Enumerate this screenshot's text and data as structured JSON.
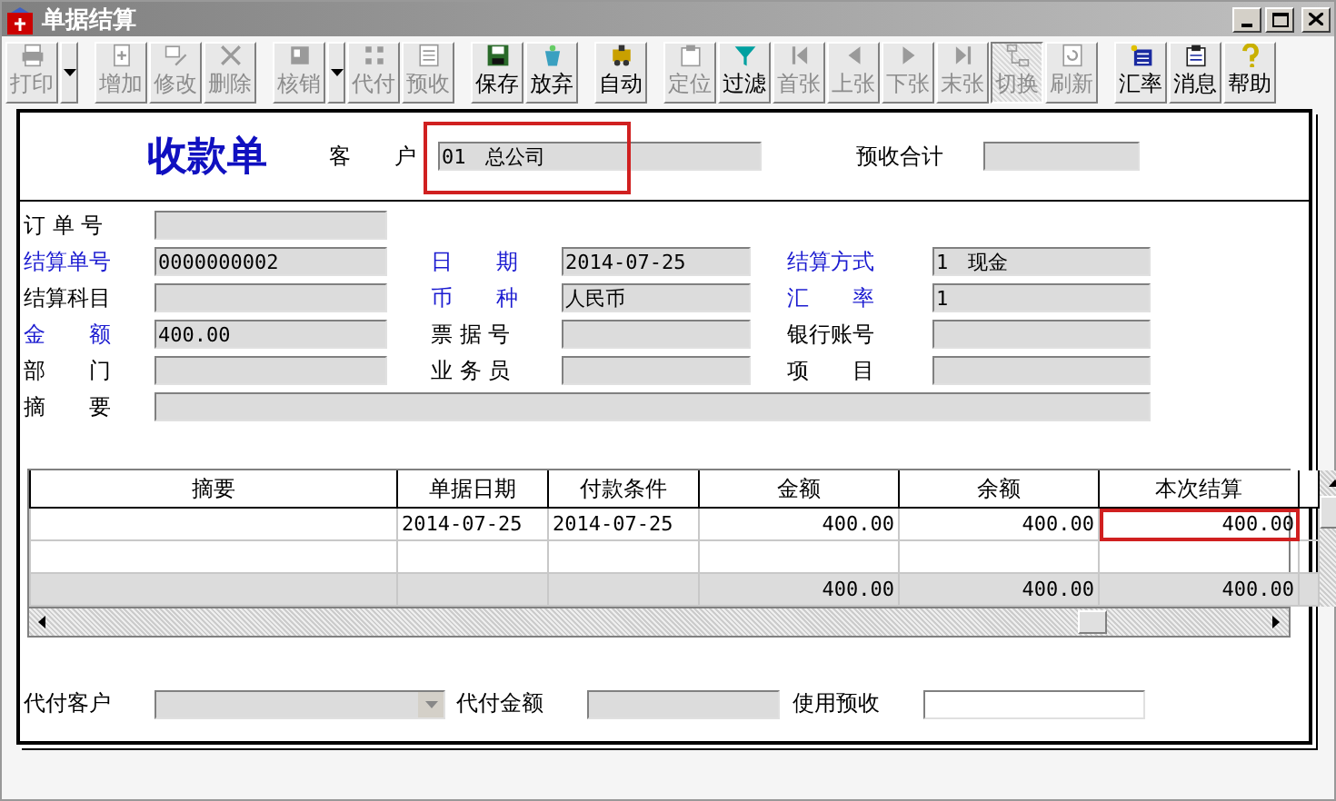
{
  "window": {
    "title": "单据结算"
  },
  "toolbar": [
    {
      "kind": "button",
      "label": "打印",
      "disabled": true,
      "pressed": false
    },
    {
      "kind": "dropdown",
      "disabled": false
    },
    {
      "kind": "spacer"
    },
    {
      "kind": "button",
      "label": "增加",
      "disabled": true,
      "pressed": false
    },
    {
      "kind": "button",
      "label": "修改",
      "disabled": true,
      "pressed": false
    },
    {
      "kind": "button",
      "label": "删除",
      "disabled": true,
      "pressed": false
    },
    {
      "kind": "spacer"
    },
    {
      "kind": "button",
      "label": "核销",
      "disabled": true,
      "pressed": false
    },
    {
      "kind": "dropdown",
      "disabled": false
    },
    {
      "kind": "button",
      "label": "代付",
      "disabled": true,
      "pressed": false
    },
    {
      "kind": "button",
      "label": "预收",
      "disabled": true,
      "pressed": false
    },
    {
      "kind": "spacer"
    },
    {
      "kind": "button",
      "label": "保存",
      "disabled": false,
      "pressed": false
    },
    {
      "kind": "button",
      "label": "放弃",
      "disabled": false,
      "pressed": false
    },
    {
      "kind": "spacer"
    },
    {
      "kind": "button",
      "label": "自动",
      "disabled": false,
      "pressed": false
    },
    {
      "kind": "spacer"
    },
    {
      "kind": "button",
      "label": "定位",
      "disabled": true,
      "pressed": false
    },
    {
      "kind": "button",
      "label": "过滤",
      "disabled": false,
      "pressed": false
    },
    {
      "kind": "button",
      "label": "首张",
      "disabled": true,
      "pressed": false
    },
    {
      "kind": "button",
      "label": "上张",
      "disabled": true,
      "pressed": false
    },
    {
      "kind": "button",
      "label": "下张",
      "disabled": true,
      "pressed": false
    },
    {
      "kind": "button",
      "label": "末张",
      "disabled": true,
      "pressed": false
    },
    {
      "kind": "button",
      "label": "切换",
      "disabled": true,
      "pressed": true
    },
    {
      "kind": "button",
      "label": "刷新",
      "disabled": true,
      "pressed": false
    },
    {
      "kind": "spacer"
    },
    {
      "kind": "button",
      "label": "汇率",
      "disabled": false,
      "pressed": false
    },
    {
      "kind": "button",
      "label": "消息",
      "disabled": false,
      "pressed": false
    },
    {
      "kind": "button",
      "label": "帮助",
      "disabled": false,
      "pressed": false
    }
  ],
  "header": {
    "title": "收款单",
    "customer": {
      "label": "客　　户",
      "value": "01　总公司",
      "highlighted": true
    },
    "prepaid_total": {
      "label": "预收合计"
    }
  },
  "form": [
    [
      {
        "label": "订 单 号",
        "required": false
      }
    ],
    [
      {
        "label": "结算单号",
        "required": true,
        "value": "0000000002"
      },
      {
        "label": "日　　期",
        "required": true,
        "value": "2014-07-25"
      },
      {
        "label": "结算方式",
        "required": true,
        "value": "1　现金"
      }
    ],
    [
      {
        "label": "结算科目",
        "required": false
      },
      {
        "label": "币　　种",
        "required": true,
        "value": "人民币"
      },
      {
        "label": "汇　　率",
        "required": true,
        "value": "1"
      }
    ],
    [
      {
        "label": "金　　额",
        "required": true,
        "value": "400.00"
      },
      {
        "label": "票 据 号",
        "required": false
      },
      {
        "label": "银行账号",
        "required": false
      }
    ],
    [
      {
        "label": "部　　门",
        "required": false
      },
      {
        "label": "业 务 员",
        "required": false
      },
      {
        "label": "项　　目",
        "required": false
      }
    ],
    [
      {
        "label": "摘　　要",
        "required": false,
        "kind": "wide"
      }
    ]
  ],
  "table": {
    "columns": [
      {
        "label": "摘要"
      },
      {
        "label": "单据日期"
      },
      {
        "label": "付款条件"
      },
      {
        "label": "金额"
      },
      {
        "label": "余额"
      },
      {
        "label": "本次结算"
      }
    ],
    "rows": [
      {
        "kind": "data",
        "cells": [
          {},
          {
            "text": "2014-07-25"
          },
          {
            "text": "2014-07-25"
          },
          {
            "text": "400.00"
          },
          {
            "text": "400.00"
          },
          {
            "text": "400.00",
            "highlighted": true
          }
        ]
      },
      {
        "kind": "data",
        "cells": [
          {},
          {},
          {},
          {},
          {},
          {}
        ]
      },
      {
        "kind": "total",
        "cells": [
          {},
          {},
          {},
          {
            "text": "400.00"
          },
          {
            "text": "400.00"
          },
          {
            "text": "400.00"
          }
        ]
      }
    ]
  },
  "footer": [
    {
      "label": "代付客户",
      "kind": "combo",
      "disabled": true
    },
    {
      "label": "代付金额",
      "kind": "field",
      "disabled": true
    },
    {
      "label": "使用预收",
      "kind": "field",
      "disabled": false
    }
  ]
}
